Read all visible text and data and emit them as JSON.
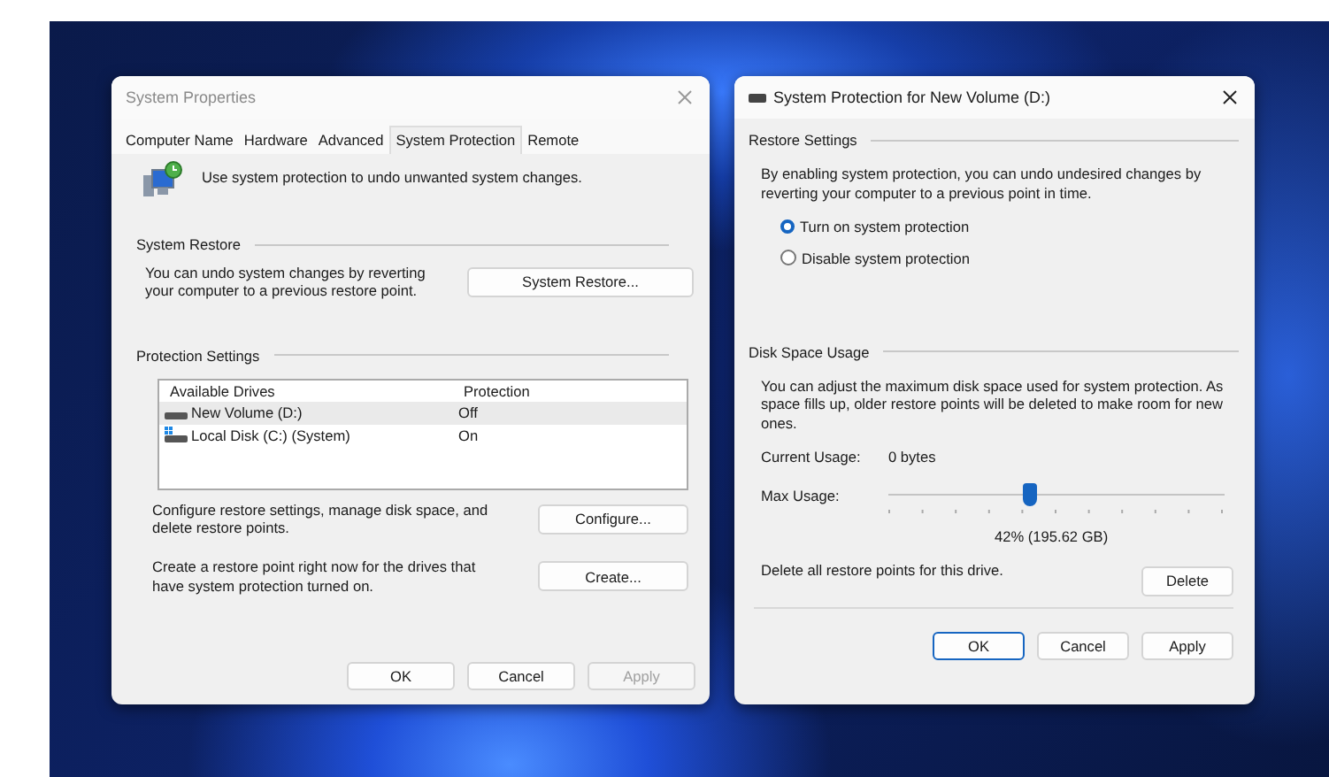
{
  "system_properties": {
    "title": "System Properties",
    "tabs": [
      {
        "label": "Computer Name",
        "selected": false
      },
      {
        "label": "Hardware",
        "selected": false
      },
      {
        "label": "Advanced",
        "selected": false
      },
      {
        "label": "System Protection",
        "selected": true
      },
      {
        "label": "Remote",
        "selected": false
      }
    ],
    "intro": "Use system protection to undo unwanted system changes.",
    "system_restore": {
      "heading": "System Restore",
      "text": "You can undo system changes by reverting your computer to a previous restore point.",
      "button": "System Restore..."
    },
    "protection_settings": {
      "heading": "Protection Settings",
      "columns": [
        "Available Drives",
        "Protection"
      ],
      "drives": [
        {
          "name": "New Volume (D:)",
          "protection": "Off",
          "kind": "drive",
          "selected": true
        },
        {
          "name": "Local Disk (C:) (System)",
          "protection": "On",
          "kind": "system",
          "selected": false
        }
      ],
      "configure_text": "Configure restore settings, manage disk space, and delete restore points.",
      "configure_button": "Configure...",
      "create_text": "Create a restore point right now for the drives that have system protection turned on.",
      "create_button": "Create..."
    },
    "buttons": [
      {
        "label": "OK",
        "disabled": false
      },
      {
        "label": "Cancel",
        "disabled": false
      },
      {
        "label": "Apply",
        "disabled": true
      }
    ]
  },
  "protection_dialog": {
    "title": "System Protection for New Volume (D:)",
    "restore_settings": {
      "heading": "Restore Settings",
      "text": "By enabling system protection, you can undo undesired changes by reverting your computer to a previous point in time.",
      "options": [
        {
          "label": "Turn on system protection",
          "selected": true
        },
        {
          "label": "Disable system protection",
          "selected": false
        }
      ]
    },
    "disk_space": {
      "heading": "Disk Space Usage",
      "text": "You can adjust the maximum disk space used for system protection. As space fills up, older restore points will be deleted to make room for new ones.",
      "current_label": "Current Usage:",
      "current_value": "0 bytes",
      "max_label": "Max Usage:",
      "level": 0.42,
      "reading": "42% (195.62 GB)",
      "delete_text": "Delete all restore points for this drive.",
      "delete_button": "Delete"
    },
    "buttons": [
      {
        "label": "OK",
        "default": true
      },
      {
        "label": "Cancel",
        "default": false
      },
      {
        "label": "Apply",
        "default": false
      }
    ]
  }
}
